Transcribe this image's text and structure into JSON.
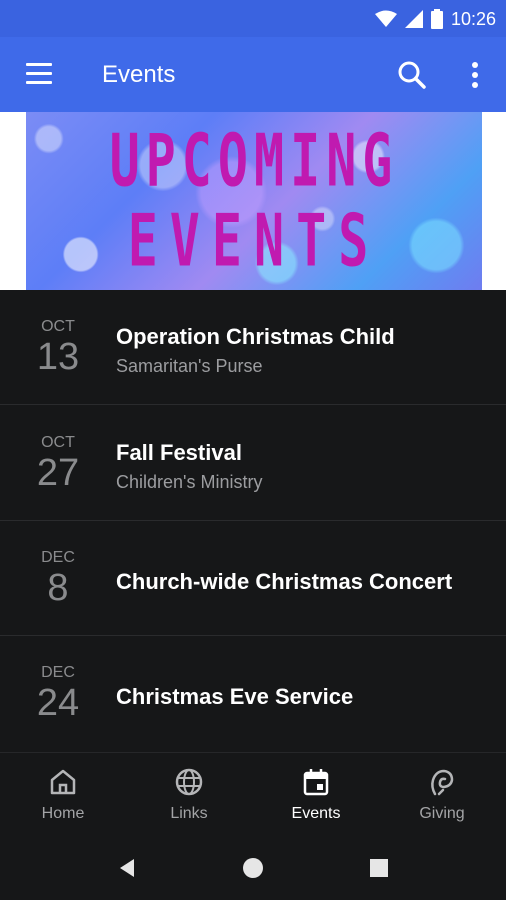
{
  "status_bar": {
    "time": "10:26"
  },
  "app_bar": {
    "title": "Events"
  },
  "banner": {
    "line1": "UPCOMING",
    "line2": "EVENTS"
  },
  "events": [
    {
      "month": "OCT",
      "day": "13",
      "title": "Operation Christmas Child",
      "subtitle": "Samaritan's Purse"
    },
    {
      "month": "OCT",
      "day": "27",
      "title": "Fall Festival",
      "subtitle": "Children's Ministry"
    },
    {
      "month": "DEC",
      "day": "8",
      "title": "Church-wide Christmas Concert",
      "subtitle": ""
    },
    {
      "month": "DEC",
      "day": "24",
      "title": "Christmas Eve Service",
      "subtitle": ""
    }
  ],
  "bottom_nav": [
    {
      "label": "Home",
      "icon": "home-icon",
      "active": false
    },
    {
      "label": "Links",
      "icon": "globe-icon",
      "active": false
    },
    {
      "label": "Events",
      "icon": "calendar-icon",
      "active": true
    },
    {
      "label": "Giving",
      "icon": "giving-icon",
      "active": false
    }
  ],
  "colors": {
    "app_bar": "#3f6ae9",
    "status_bar": "#3a63e0",
    "background": "#161718",
    "banner_text": "#c01ab0"
  }
}
